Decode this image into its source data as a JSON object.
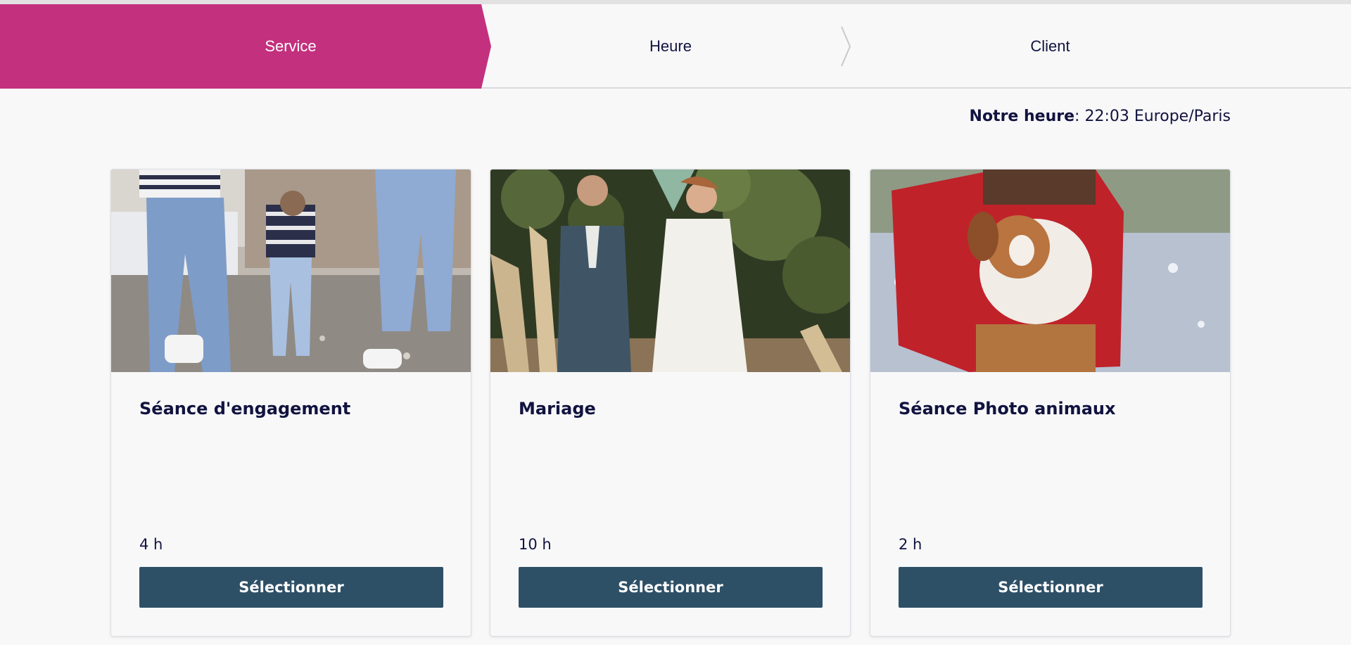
{
  "colors": {
    "accent": "#c3307e",
    "button": "#2e5067",
    "text": "#11133f",
    "background": "#f8f8f9"
  },
  "steps": [
    {
      "label": "Service",
      "active": true
    },
    {
      "label": "Heure",
      "active": false
    },
    {
      "label": "Client",
      "active": false
    }
  ],
  "timezone_notice": {
    "label": "Notre heure",
    "separator": ":",
    "value": " 22:03 Europe/Paris"
  },
  "services": [
    {
      "title": "Séance d'engagement",
      "duration": "4 h",
      "button_label": "Sélectionner",
      "image": "family-walking-on-beach-photo"
    },
    {
      "title": "Mariage",
      "duration": "10 h",
      "button_label": "Sélectionner",
      "image": "wedding-couple-seated-photo"
    },
    {
      "title": "Séance Photo animaux",
      "duration": "2 h",
      "button_label": "Sélectionner",
      "image": "dog-in-snow-photo"
    }
  ]
}
